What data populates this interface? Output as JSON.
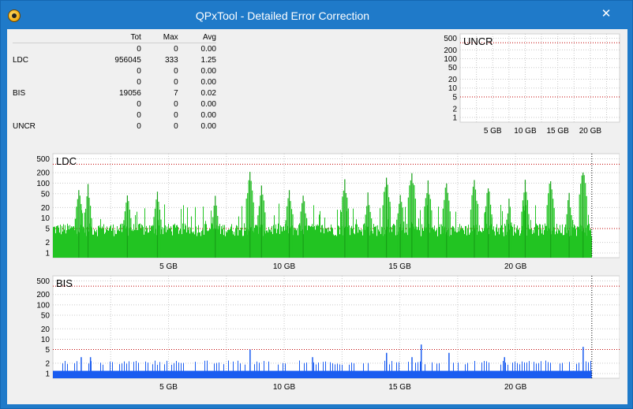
{
  "window": {
    "title": "QPxTool - Detailed Error Correction",
    "close_glyph": "✕"
  },
  "colors": {
    "title_bar": "#1f7ac9",
    "ldc_light": "#22c422",
    "ldc_dark": "#0b7a0b",
    "bis_blue": "#1a5cf0",
    "threshold_red": "#c00000"
  },
  "stats": {
    "headers": [
      "",
      "Tot",
      "Max",
      "Avg"
    ],
    "rows": [
      [
        "",
        "0",
        "0",
        "0.00"
      ],
      [
        "LDC",
        "956045",
        "333",
        "1.25"
      ],
      [
        "",
        "0",
        "0",
        "0.00"
      ],
      [
        "",
        "0",
        "0",
        "0.00"
      ],
      [
        "BIS",
        "19056",
        "7",
        "0.02"
      ],
      [
        "",
        "0",
        "0",
        "0.00"
      ],
      [
        "",
        "0",
        "0",
        "0.00"
      ],
      [
        "UNCR",
        "0",
        "0",
        "0.00"
      ]
    ]
  },
  "chart_data": [
    {
      "type": "bar",
      "title": "UNCR",
      "y_scale": "log",
      "y_ticks": [
        "500",
        "200",
        "100",
        "50",
        "20",
        "10",
        "5",
        "2",
        "1"
      ],
      "x_ticks": [
        "5 GB",
        "10 GB",
        "15 GB",
        "20 GB"
      ],
      "x_unit": "GB",
      "xlim": [
        0,
        24.5
      ],
      "threshold_lines": [
        350,
        5
      ],
      "grid": true,
      "series": [
        {
          "values": []
        }
      ]
    },
    {
      "type": "bar",
      "title": "LDC",
      "y_scale": "log",
      "y_ticks": [
        "500",
        "200",
        "100",
        "50",
        "20",
        "10",
        "5",
        "2",
        "1"
      ],
      "x_ticks": [
        "5 GB",
        "10 GB",
        "15 GB",
        "20 GB"
      ],
      "x_unit": "GB",
      "xlim": [
        0,
        24.5
      ],
      "data_extent_gb": 23.3,
      "threshold_lines": [
        350,
        5
      ],
      "grid": true,
      "typical_level": 5,
      "max": 333,
      "spikes": [
        {
          "x": 1.1,
          "y": 90
        },
        {
          "x": 1.5,
          "y": 95
        },
        {
          "x": 3.2,
          "y": 60
        },
        {
          "x": 4.5,
          "y": 70
        },
        {
          "x": 7.0,
          "y": 50
        },
        {
          "x": 8.5,
          "y": 230
        },
        {
          "x": 9.0,
          "y": 120
        },
        {
          "x": 10.2,
          "y": 80
        },
        {
          "x": 10.8,
          "y": 60
        },
        {
          "x": 12.6,
          "y": 150
        },
        {
          "x": 13.6,
          "y": 60
        },
        {
          "x": 14.4,
          "y": 190
        },
        {
          "x": 15.0,
          "y": 70
        },
        {
          "x": 15.5,
          "y": 300
        },
        {
          "x": 16.2,
          "y": 130
        },
        {
          "x": 17.0,
          "y": 150
        },
        {
          "x": 18.2,
          "y": 160
        },
        {
          "x": 18.8,
          "y": 110
        },
        {
          "x": 19.7,
          "y": 40
        },
        {
          "x": 20.4,
          "y": 130
        },
        {
          "x": 21.5,
          "y": 180
        },
        {
          "x": 22.3,
          "y": 60
        },
        {
          "x": 22.9,
          "y": 333
        }
      ]
    },
    {
      "type": "bar",
      "title": "BIS",
      "y_scale": "log",
      "y_ticks": [
        "500",
        "200",
        "100",
        "50",
        "20",
        "10",
        "5",
        "2",
        "1"
      ],
      "x_ticks": [
        "5 GB",
        "10 GB",
        "15 GB",
        "20 GB"
      ],
      "x_unit": "GB",
      "xlim": [
        0,
        24.5
      ],
      "data_extent_gb": 23.3,
      "threshold_lines": [
        350,
        5
      ],
      "grid": true,
      "typical_level": 2,
      "max": 7,
      "spikes": [
        {
          "x": 1.2,
          "y": 3
        },
        {
          "x": 1.6,
          "y": 3
        },
        {
          "x": 8.5,
          "y": 5
        },
        {
          "x": 11.2,
          "y": 3
        },
        {
          "x": 14.4,
          "y": 4
        },
        {
          "x": 15.5,
          "y": 3
        },
        {
          "x": 15.9,
          "y": 7
        },
        {
          "x": 17.1,
          "y": 4
        },
        {
          "x": 19.5,
          "y": 3
        },
        {
          "x": 22.9,
          "y": 6
        }
      ]
    }
  ]
}
